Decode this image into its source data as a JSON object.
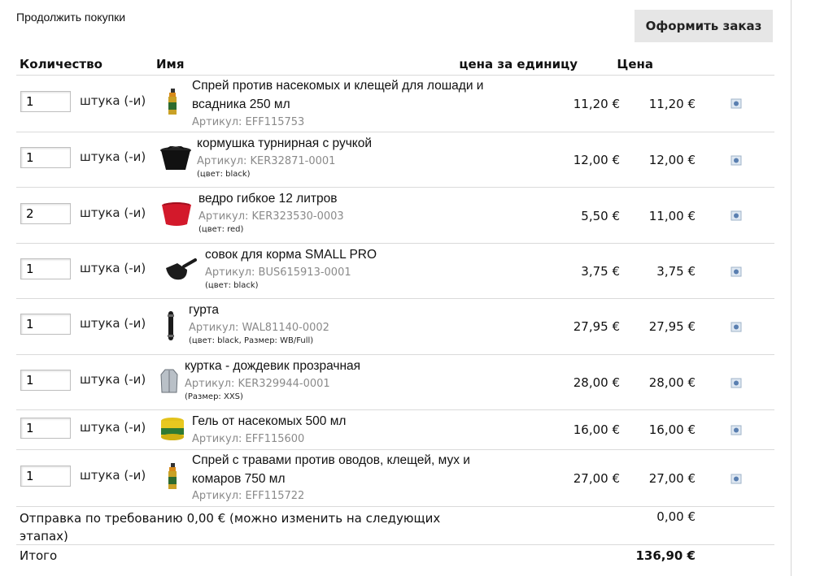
{
  "actions": {
    "continue_label": "Продолжить покупки",
    "checkout_label": "Оформить заказ"
  },
  "headers": {
    "quantity": "Количество",
    "name": "Имя",
    "unit_price": "цена за единицу",
    "price": "Цена"
  },
  "unit_label": "штука (-и)",
  "items": [
    {
      "qty": "1",
      "name_lines": [
        "Спрей против насекомых и клещей для лошади и",
        "всадника 250 мл"
      ],
      "sku": "Артикул: EFF115753",
      "variant": "",
      "unit_price": "11,20 €",
      "price": "11,20 €",
      "image_icon": "spray-bottle-icon"
    },
    {
      "qty": "1",
      "name_lines": [
        "кормушка турнирная с ручкой"
      ],
      "sku": "Артикул: KER32871-0001",
      "variant": "(цвет: black)",
      "unit_price": "12,00 €",
      "price": "12,00 €",
      "image_icon": "feeder-tub-icon"
    },
    {
      "qty": "2",
      "name_lines": [
        "ведро гибкое 12 литров"
      ],
      "sku": "Артикул: KER323530-0003",
      "variant": "(цвет: red)",
      "unit_price": "5,50 €",
      "price": "11,00 €",
      "image_icon": "flex-bucket-icon"
    },
    {
      "qty": "1",
      "name_lines": [
        "совок для корма SMALL PRO"
      ],
      "sku": "Артикул: BUS615913-0001",
      "variant": "(цвет: black)",
      "unit_price": "3,75 €",
      "price": "3,75 €",
      "image_icon": "feed-scoop-icon"
    },
    {
      "qty": "1",
      "name_lines": [
        "гурта"
      ],
      "sku": "Артикул: WAL81140-0002",
      "variant": "(цвет: black, Размер: WB/Full)",
      "unit_price": "27,95 €",
      "price": "27,95 €",
      "image_icon": "girth-icon"
    },
    {
      "qty": "1",
      "name_lines": [
        "куртка - дождевик прозрачная"
      ],
      "sku": "Артикул: KER329944-0001",
      "variant": "(Размер: XXS)",
      "unit_price": "28,00 €",
      "price": "28,00 €",
      "image_icon": "rain-jacket-icon"
    },
    {
      "qty": "1",
      "name_lines": [
        "Гель от насекомых 500 мл"
      ],
      "sku": "Артикул: EFF115600",
      "variant": "",
      "unit_price": "16,00 €",
      "price": "16,00 €",
      "image_icon": "gel-tub-icon"
    },
    {
      "qty": "1",
      "name_lines": [
        "Спрей с травами против оводов, клещей, мух и",
        "комаров 750 мл"
      ],
      "sku": "Артикул: EFF115722",
      "variant": "",
      "unit_price": "27,00 €",
      "price": "27,00 €",
      "image_icon": "spray-bottle-icon"
    }
  ],
  "shipping": {
    "label": "Отправка по требованию 0,00 € (можно изменить на следующих этапах)",
    "value": "0,00 €"
  },
  "total": {
    "label": "Итого",
    "value": "136,90 €"
  }
}
